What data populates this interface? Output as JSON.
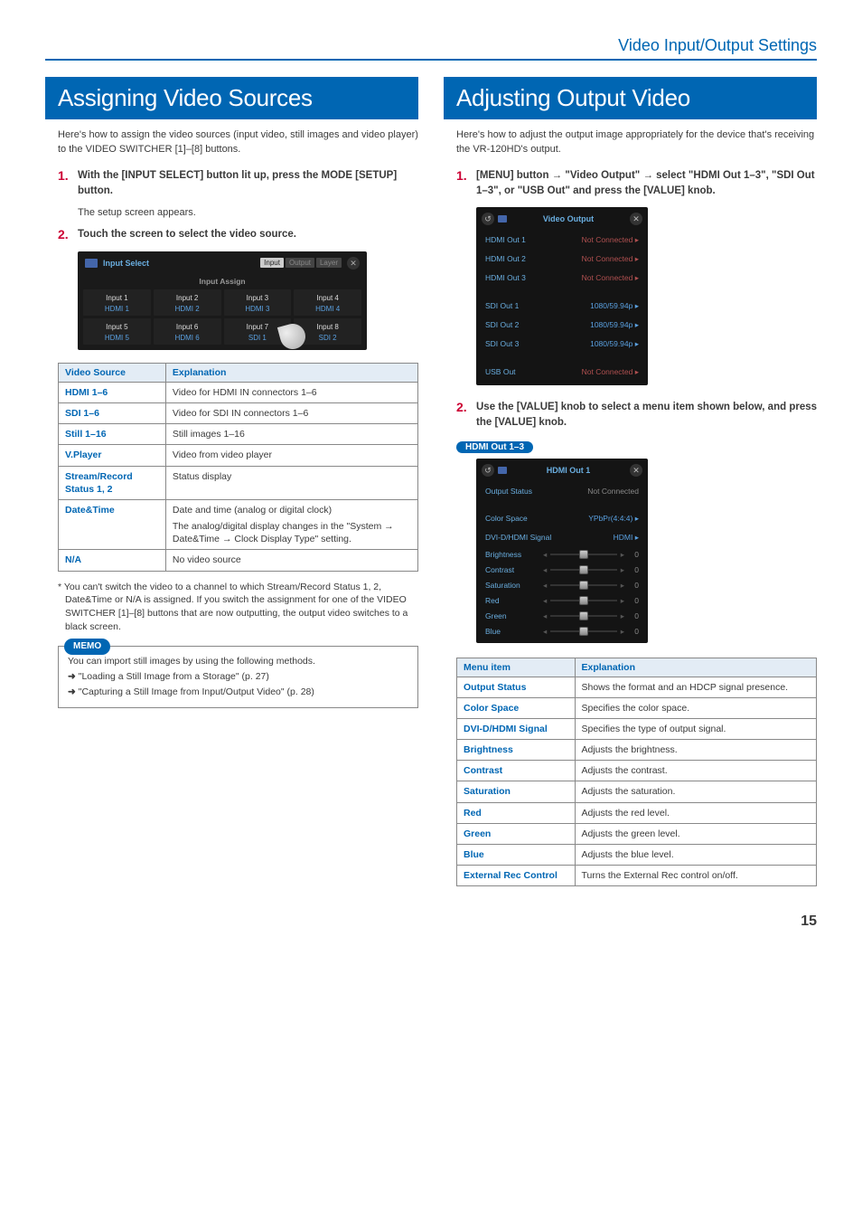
{
  "breadcrumb": "Video Input/Output Settings",
  "page_number": "15",
  "left": {
    "title": "Assigning Video Sources",
    "intro": "Here's how to assign the video sources (input video, still images and video player) to the VIDEO SWITCHER [1]–[8] buttons.",
    "step1": "With the [INPUT SELECT] button lit up, press the MODE [SETUP] button.",
    "step1_sub": "The setup screen appears.",
    "step2": "Touch the screen to select the video source.",
    "fig": {
      "window_title": "Input Select",
      "panel_label": "Input Assign",
      "tabs": [
        "Input",
        "Output",
        "Layer"
      ],
      "cells": [
        {
          "top": "Input 1",
          "bot": "HDMI 1"
        },
        {
          "top": "Input 2",
          "bot": "HDMI 2"
        },
        {
          "top": "Input 3",
          "bot": "HDMI 3"
        },
        {
          "top": "Input 4",
          "bot": "HDMI 4"
        },
        {
          "top": "Input 5",
          "bot": "HDMI 5"
        },
        {
          "top": "Input 6",
          "bot": "HDMI 6"
        },
        {
          "top": "Input 7",
          "bot": "SDI 1"
        },
        {
          "top": "Input 8",
          "bot": "SDI 2"
        }
      ]
    },
    "table_hdr": {
      "c1": "Video Source",
      "c2": "Explanation"
    },
    "table": [
      {
        "k": "HDMI 1–6",
        "v": "Video for HDMI IN connectors 1–6"
      },
      {
        "k": "SDI 1–6",
        "v": "Video for SDI IN connectors 1–6"
      },
      {
        "k": "Still 1–16",
        "v": "Still images 1–16"
      },
      {
        "k": "V.Player",
        "v": "Video from video player"
      },
      {
        "k": "Stream/Record Status 1, 2",
        "v": "Status display"
      },
      {
        "k": "Date&Time",
        "v": "Date and time (analog or digital clock)\nThe analog/digital display changes in the \"System → Date&Time → Clock Display Type\" setting."
      },
      {
        "k": "N/A",
        "v": "No video source"
      }
    ],
    "footnote": "* You can't switch the video to a channel to which Stream/Record Status 1, 2, Date&Time or N/A is assigned. If you switch the assignment for one of the VIDEO SWITCHER [1]–[8] buttons that are now outputting, the output video switches to a black screen.",
    "memo_label": "MEMO",
    "memo_intro": "You can import still images by using the following methods.",
    "memo_l1": "\"Loading a Still Image from a Storage\" (p. 27)",
    "memo_l2": "\"Capturing a Still Image from Input/Output Video\" (p. 28)"
  },
  "right": {
    "title": "Adjusting Output Video",
    "intro": "Here's how to adjust the output image appropriately for the device that's receiving the VR-120HD's output.",
    "step1": "[MENU] button → \"Video Output\" → select \"HDMI Out 1–3\", \"SDI Out 1–3\", or \"USB Out\" and press the [VALUE] knob.",
    "fig1": {
      "title": "Video Output",
      "rows": [
        {
          "l": "HDMI Out 1",
          "v": "Not Connected",
          "cls": "val"
        },
        {
          "l": "HDMI Out 2",
          "v": "Not Connected",
          "cls": "val"
        },
        {
          "l": "HDMI Out 3",
          "v": "Not Connected",
          "cls": "val"
        },
        {
          "l": "SDI Out 1",
          "v": "1080/59.94p",
          "cls": "val g"
        },
        {
          "l": "SDI Out 2",
          "v": "1080/59.94p",
          "cls": "val g"
        },
        {
          "l": "SDI Out 3",
          "v": "1080/59.94p",
          "cls": "val g"
        },
        {
          "l": "USB Out",
          "v": "Not Connected",
          "cls": "val"
        }
      ]
    },
    "step2": "Use the [VALUE] knob to select a menu item shown below, and press the [VALUE] knob.",
    "loz": "HDMI Out 1–3",
    "fig2": {
      "title": "HDMI Out 1",
      "status_l": "Output Status",
      "status_v": "Not Connected",
      "rows": [
        {
          "l": "Color Space",
          "v": "YPbPr(4:4:4)"
        },
        {
          "l": "DVI-D/HDMI Signal",
          "v": "HDMI"
        }
      ],
      "sliders": [
        {
          "l": "Brightness",
          "p": 50,
          "v": "0"
        },
        {
          "l": "Contrast",
          "p": 50,
          "v": "0"
        },
        {
          "l": "Saturation",
          "p": 50,
          "v": "0"
        },
        {
          "l": "Red",
          "p": 50,
          "v": "0"
        },
        {
          "l": "Green",
          "p": 50,
          "v": "0"
        },
        {
          "l": "Blue",
          "p": 50,
          "v": "0"
        }
      ]
    },
    "table_hdr": {
      "c1": "Menu item",
      "c2": "Explanation"
    },
    "table": [
      {
        "k": "Output Status",
        "v": "Shows the format and an HDCP signal presence."
      },
      {
        "k": "Color Space",
        "v": "Specifies the color space."
      },
      {
        "k": "DVI-D/HDMI Signal",
        "v": "Specifies the type of output signal."
      },
      {
        "k": "Brightness",
        "v": "Adjusts the brightness."
      },
      {
        "k": "Contrast",
        "v": "Adjusts the contrast."
      },
      {
        "k": "Saturation",
        "v": "Adjusts the saturation."
      },
      {
        "k": "Red",
        "v": "Adjusts the red level."
      },
      {
        "k": "Green",
        "v": "Adjusts the green level."
      },
      {
        "k": "Blue",
        "v": "Adjusts the blue level."
      },
      {
        "k": "External Rec Control",
        "v": "Turns the External Rec control on/off."
      }
    ]
  }
}
